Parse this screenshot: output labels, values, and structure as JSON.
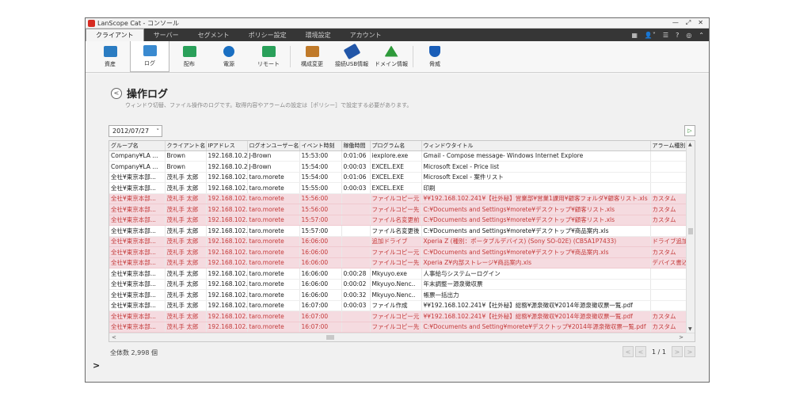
{
  "window": {
    "title": "LanScope Cat - コンソール"
  },
  "menu": {
    "tabs": [
      "クライアント",
      "サーバー",
      "セグメント",
      "ポリシー設定",
      "環境設定",
      "アカウント"
    ],
    "right_icons": [
      "building-icon",
      "user-icon",
      "list-icon",
      "help-icon",
      "globe-icon",
      "collapse-icon"
    ]
  },
  "toolbar": {
    "items": [
      {
        "label": "資産",
        "color": "#2b7cc2"
      },
      {
        "label": "ログ",
        "color": "#3a8ad0"
      },
      {
        "label": "配布",
        "color": "#2aa05a"
      },
      {
        "label": "電源",
        "color": "#1a6fc2"
      },
      {
        "label": "リモート",
        "color": "#2aa05a"
      },
      {
        "label": "構成変更",
        "color": "#c07a2a"
      },
      {
        "label": "接続USB情報",
        "color": "#2256a8"
      },
      {
        "label": "ドメイン情報",
        "color": "#2e9a3a"
      },
      {
        "label": "脅威",
        "color": "#1a5eb8"
      }
    ]
  },
  "page": {
    "title": "操作ログ",
    "description": "ウィンドウ切替、ファイル操作のログです。取得内容やアラームの設定は［ポリシー］で設定する必要があります。",
    "date": "2012/07/27",
    "total": "全体数 2,998 個",
    "pager": "1 / 1"
  },
  "table": {
    "headers": [
      "グループ名",
      "クライアント名",
      "IPアドレス",
      "ログオンユーザー名",
      "イベント時刻",
      "稼働時間",
      "プログラム名",
      "ウィンドウタイトル",
      "アラーム種別"
    ],
    "rows": [
      {
        "alert": false,
        "cells": [
          "Company¥LA ...",
          "Brown",
          "192.168.10.2",
          "J-Brown",
          "15:53:00",
          "0:01:06",
          "iexplore.exe",
          "Gmail - Compose message- Windows Internet Explore",
          ""
        ]
      },
      {
        "alert": false,
        "cells": [
          "Company¥LA ...",
          "Brown",
          "192.168.10.2",
          "J-Brown",
          "15:54:00",
          "0:00:03",
          "EXCEL.EXE",
          "Microsoft Excel - Price list",
          ""
        ]
      },
      {
        "alert": false,
        "cells": [
          "全社¥東京本部...",
          "茂礼手 太郎",
          "192.168.102...",
          "taro.morete",
          "15:54:00",
          "0:01:06",
          "EXCEL.EXE",
          "Microsoft Excel - 案件リスト",
          ""
        ]
      },
      {
        "alert": false,
        "cells": [
          "全社¥東京本部...",
          "茂礼手 太郎",
          "192.168.102...",
          "taro.morete",
          "15:55:00",
          "0:00:03",
          "EXCEL.EXE",
          "印刷",
          ""
        ]
      },
      {
        "alert": true,
        "cells": [
          "全社¥東京本部...",
          "茂礼手 太郎",
          "192.168.102...",
          "taro.morete",
          "15:56:00",
          "",
          "ファイルコピー元",
          "¥¥192.168.102.241¥【社外秘】営業部¥営業1課用¥顧客フォルダ¥顧客リスト.xls",
          "カスタム"
        ]
      },
      {
        "alert": true,
        "cells": [
          "全社¥東京本部...",
          "茂礼手 太郎",
          "192.168.102...",
          "taro.morete",
          "15:56:00",
          "",
          "ファイルコピー先",
          "C:¥Documents and Settings¥morete¥デスクトップ¥顧客リスト.xls",
          "カスタム"
        ]
      },
      {
        "alert": true,
        "cells": [
          "全社¥東京本部...",
          "茂礼手 太郎",
          "192.168.102...",
          "taro.morete",
          "15:57:00",
          "",
          "ファイル名変更前",
          "C:¥Documents and Settings¥morete¥デスクトップ¥顧客リスト.xls",
          "カスタム"
        ]
      },
      {
        "alert": false,
        "cells": [
          "全社¥東京本部...",
          "茂礼手 太郎",
          "192.168.102...",
          "taro.morete",
          "15:57:00",
          "",
          "ファイル名変更後",
          "C:¥Documents and Settings¥morete¥デスクトップ¥商品案内.xls",
          ""
        ]
      },
      {
        "alert": true,
        "cells": [
          "全社¥東京本部...",
          "茂礼手 太郎",
          "192.168.102...",
          "taro.morete",
          "16:06:00",
          "",
          "追加ドライブ",
          "Xperia Z (種別：ポータブルデバイス) (Sony SO-02E) (CB5A1P7433)",
          "ドライブ追加"
        ]
      },
      {
        "alert": true,
        "cells": [
          "全社¥東京本部...",
          "茂礼手 太郎",
          "192.168.102...",
          "taro.morete",
          "16:06:00",
          "",
          "ファイルコピー元",
          "C:¥Documents and Settings¥morete¥デスクトップ¥商品案内.xls",
          "カスタム"
        ]
      },
      {
        "alert": true,
        "cells": [
          "全社¥東京本部...",
          "茂礼手 太郎",
          "192.168.102...",
          "taro.morete",
          "16:06:00",
          "",
          "ファイルコピー先",
          "Xperia Z¥内部ストレージ¥商品案内.xls",
          "デバイス書込"
        ]
      },
      {
        "alert": false,
        "cells": [
          "全社¥東京本部...",
          "茂礼手 太郎",
          "192.168.102...",
          "taro.morete",
          "16:06:00",
          "0:00:28",
          "Mkyuyo.exe",
          "人事給与システムーログイン",
          ""
        ]
      },
      {
        "alert": false,
        "cells": [
          "全社¥東京本部...",
          "茂礼手 太郎",
          "192.168.102...",
          "taro.morete",
          "16:06:00",
          "0:00:02",
          "Mkyuyo.Nenc..",
          "年末調整ー源泉徴収票",
          ""
        ]
      },
      {
        "alert": false,
        "cells": [
          "全社¥東京本部...",
          "茂礼手 太郎",
          "192.168.102...",
          "taro.morete",
          "16:06:00",
          "0:00:32",
          "Mkyuyo.Nenc..",
          "帳票一括出力",
          ""
        ]
      },
      {
        "alert": false,
        "cells": [
          "全社¥東京本部...",
          "茂礼手 太郎",
          "192.168.102...",
          "taro.morete",
          "16:07:00",
          "0:00:03",
          "ファイル作成",
          "¥¥192.168.102.241¥【社外秘】総務¥源泉徴収¥2014年源泉徴収票一覧.pdf",
          ""
        ]
      },
      {
        "alert": true,
        "cells": [
          "全社¥東京本部...",
          "茂礼手 太郎",
          "192.168.102...",
          "taro.morete",
          "16:07:00",
          "",
          "ファイルコピー元",
          "¥¥192.168.102.241¥【社外秘】総務¥源泉徴収¥2014年源泉徴収票一覧.pdf",
          "カスタム"
        ]
      },
      {
        "alert": true,
        "cells": [
          "全社¥東京本部...",
          "茂礼手 太郎",
          "192.168.102...",
          "taro.morete",
          "16:07:00",
          "",
          "ファイルコピー先",
          "C:¥Documents and Setting¥morete¥デスクトップ¥2014年源泉徴収票一覧.pdf",
          "カスタム"
        ]
      }
    ]
  },
  "colors": {
    "alert_bg": "#f5dbe0",
    "alert_text": "#c43a3a",
    "menubar": "#363636"
  }
}
